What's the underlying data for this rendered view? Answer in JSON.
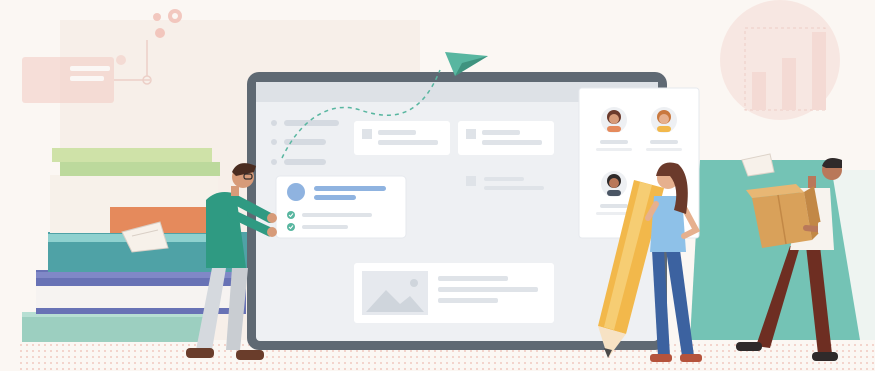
{
  "illustration": {
    "icons": [
      "gear-icon",
      "paper-plane-icon",
      "image-placeholder-icon",
      "bar-chart-icon",
      "check-icon",
      "pencil-icon",
      "box-icon"
    ],
    "colors": {
      "background": "#fbf7f3",
      "floor_dots": "#f1c9c0",
      "monitor_frame": "#5f6973",
      "screen": "#eef0f3",
      "card": "#ffffff",
      "accent_blue": "#8fb3e0",
      "accent_teal": "#58b6a0",
      "book_green": "#bcd99c",
      "book_orange": "#e58a5c",
      "book_teal": "#4fa2a6",
      "book_purple": "#6872b5",
      "pencil": "#f2b84b",
      "box": "#d9a15a",
      "chart_pink": "#f0c7c1"
    },
    "profiles": [
      {
        "hair": "#6b3a2b",
        "skin": "#d79b79"
      },
      {
        "hair": "#c9783e",
        "skin": "#e6b08e"
      },
      {
        "hair": "#2f2a2a",
        "skin": "#b9785a"
      }
    ]
  }
}
